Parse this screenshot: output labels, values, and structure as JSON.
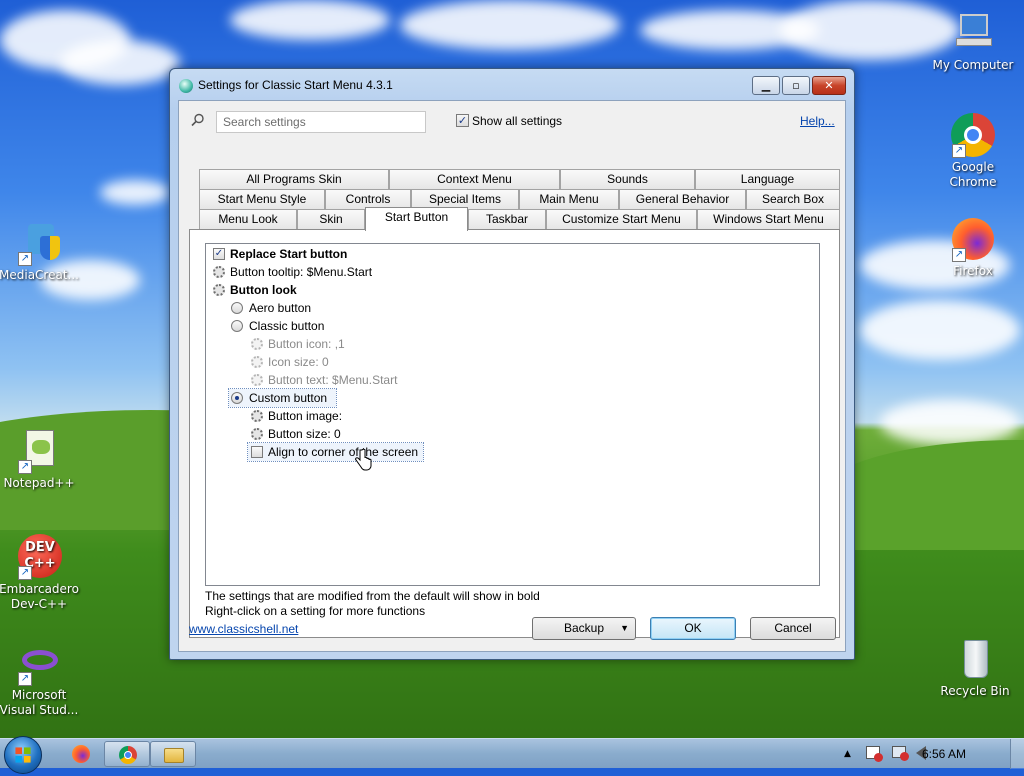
{
  "desktop": {
    "icons": [
      {
        "label": "My Computer"
      },
      {
        "label": "Google Chrome"
      },
      {
        "label": "Firefox"
      },
      {
        "label": "MediaCreat..."
      },
      {
        "label": "Notepad++"
      },
      {
        "label": "Embarcadero Dev-C++"
      },
      {
        "label": "Microsoft Visual Stud..."
      },
      {
        "label": "Recycle Bin"
      }
    ]
  },
  "window": {
    "title": "Settings for Classic Start Menu 4.3.1",
    "search_placeholder": "Search settings",
    "show_all_label": "Show all settings",
    "show_all_checked": true,
    "help_link": "Help...",
    "tabs_row1": [
      "All Programs Skin",
      "Context Menu",
      "Sounds",
      "Language"
    ],
    "tabs_row2": [
      "Start Menu Style",
      "Controls",
      "Special Items",
      "Main Menu",
      "General Behavior",
      "Search Box"
    ],
    "tabs_row3": [
      "Menu Look",
      "Skin",
      "Start Button",
      "Taskbar",
      "Customize Start Menu",
      "Windows Start Menu"
    ],
    "active_tab": "Start Button",
    "settings": [
      {
        "text": "Replace Start button",
        "kind": "checkbox",
        "checked": true
      },
      {
        "text": "Button tooltip: $Menu.Start",
        "kind": "gear"
      },
      {
        "text": "Button look",
        "kind": "gear"
      },
      {
        "text": "Aero button",
        "kind": "radio"
      },
      {
        "text": "Classic button",
        "kind": "radio"
      },
      {
        "text": "Button icon: ,1",
        "kind": "gear"
      },
      {
        "text": "Icon size: 0",
        "kind": "gear"
      },
      {
        "text": "Button text: $Menu.Start",
        "kind": "gear"
      },
      {
        "text": "Custom button",
        "kind": "radio",
        "selected": true
      },
      {
        "text": "Button image:",
        "kind": "gear"
      },
      {
        "text": "Button size: 0",
        "kind": "gear"
      },
      {
        "text": "Align to corner of the screen",
        "kind": "checkbox",
        "checked": false
      }
    ],
    "hint_line1": "The settings that are modified from the default will show in bold",
    "hint_line2": "Right-click on a setting for more functions",
    "website_link": "www.classicshell.net",
    "backup_label": "Backup",
    "ok_label": "OK",
    "cancel_label": "Cancel"
  },
  "taskbar": {
    "clock": "6:56 AM",
    "tray_up_arrow": "▲"
  }
}
